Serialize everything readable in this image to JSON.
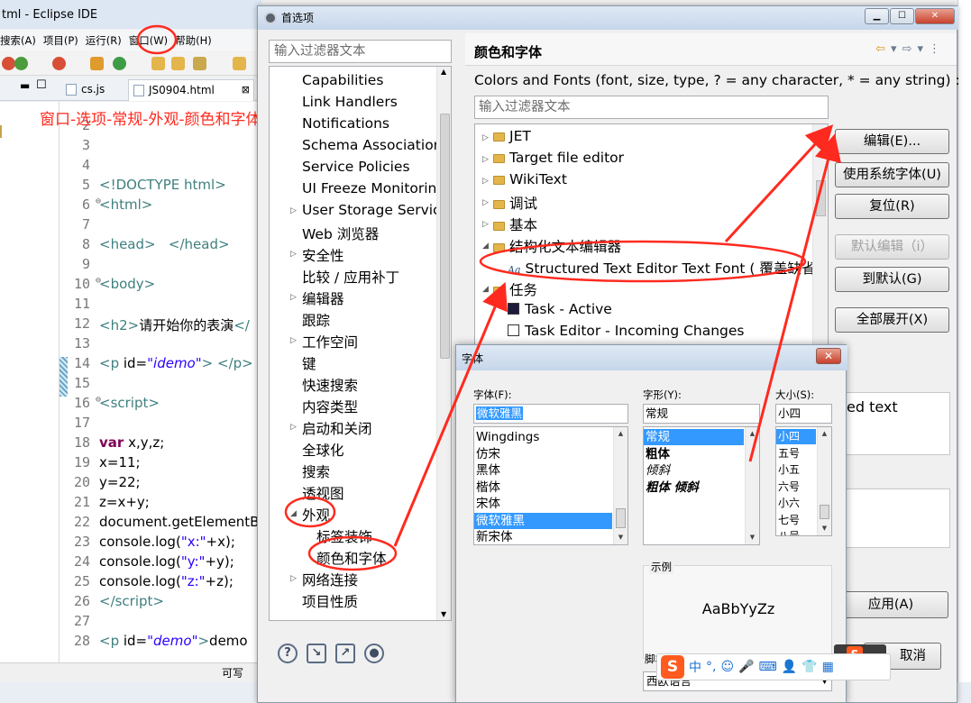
{
  "eclipse": {
    "title": "tml - Eclipse IDE",
    "menu": [
      "搜索(A)",
      "项目(P)",
      "运行(R)",
      "窗口(W)",
      "帮助(H)"
    ],
    "tabs": [
      {
        "label": "cs.js"
      },
      {
        "label": "JS0904.html"
      }
    ],
    "annotation": "窗口-选项-常规-外观-颜色和字体",
    "status": "可写",
    "lines": [
      {
        "num": "2",
        "html": ""
      },
      {
        "num": "3",
        "html": ""
      },
      {
        "num": "4",
        "html": ""
      },
      {
        "num": "5",
        "html": "<span class='tag'>&lt;!DOCTYPE html&gt;</span>"
      },
      {
        "num": "6",
        "html": "<span class='tag'>&lt;html&gt;</span>",
        "fold": true
      },
      {
        "num": "7",
        "html": ""
      },
      {
        "num": "8",
        "html": "<span class='tag'>&lt;head&gt;</span>&nbsp;&nbsp;&nbsp;<span class='tag'>&lt;/head&gt;</span>"
      },
      {
        "num": "9",
        "html": ""
      },
      {
        "num": "10",
        "html": "<span class='tag'>&lt;body&gt;</span>",
        "fold": true
      },
      {
        "num": "11",
        "html": ""
      },
      {
        "num": "12",
        "html": "<span class='tag'>&lt;h2&gt;</span>请开始你的表演<span class='tag'>&lt;/</span>"
      },
      {
        "num": "13",
        "html": ""
      },
      {
        "num": "14",
        "html": "<span class='tag'>&lt;p</span> id=<span class='attrv'>\"idemo\"</span><span class='tag'>&gt;</span> <span class='tag'>&lt;/p&gt;</span>"
      },
      {
        "num": "15",
        "html": ""
      },
      {
        "num": "16",
        "html": "<span class='tag'>&lt;script&gt;</span>",
        "fold": true
      },
      {
        "num": "17",
        "html": ""
      },
      {
        "num": "18",
        "html": "<span class='kw'>var</span> x,y,z;"
      },
      {
        "num": "19",
        "html": "x=11;"
      },
      {
        "num": "20",
        "html": "y=22;"
      },
      {
        "num": "21",
        "html": "z=x+y;"
      },
      {
        "num": "22",
        "html": "document.getElementB"
      },
      {
        "num": "23",
        "html": " console.log(<span class='str'>\"x:\"</span>+x);"
      },
      {
        "num": "24",
        "html": " console.log(<span class='str'>\"y:\"</span>+y);"
      },
      {
        "num": "25",
        "html": " console.log(<span class='str'>\"z:\"</span>+z);"
      },
      {
        "num": "26",
        "html": "<span class='tag'>&lt;/script&gt;</span>"
      },
      {
        "num": "27",
        "html": ""
      },
      {
        "num": "28",
        "html": "<span class='tag'>&lt;p</span> id=<span class='attrv'>\"demo\"</span><span class='tag'>&gt;</span>demo"
      }
    ]
  },
  "prefs": {
    "title": "首选项",
    "filter_placeholder": "输入过滤器文本",
    "tree": [
      {
        "label": "Capabilities",
        "level": 1,
        "arrow": ""
      },
      {
        "label": "Link Handlers",
        "level": 1,
        "arrow": ""
      },
      {
        "label": "Notifications",
        "level": 1,
        "arrow": ""
      },
      {
        "label": "Schema Association",
        "level": 1,
        "arrow": ""
      },
      {
        "label": "Service Policies",
        "level": 1,
        "arrow": ""
      },
      {
        "label": "UI Freeze Monitorin",
        "level": 1,
        "arrow": ""
      },
      {
        "label": "User Storage Servic",
        "level": 1,
        "arrow": "▷"
      },
      {
        "label": "Web 浏览器",
        "level": 1,
        "arrow": ""
      },
      {
        "label": "安全性",
        "level": 1,
        "arrow": "▷"
      },
      {
        "label": "比较 / 应用补丁",
        "level": 1,
        "arrow": ""
      },
      {
        "label": "编辑器",
        "level": 1,
        "arrow": "▷"
      },
      {
        "label": "跟踪",
        "level": 1,
        "arrow": ""
      },
      {
        "label": "工作空间",
        "level": 1,
        "arrow": "▷"
      },
      {
        "label": "键",
        "level": 1,
        "arrow": ""
      },
      {
        "label": "快速搜索",
        "level": 1,
        "arrow": ""
      },
      {
        "label": "内容类型",
        "level": 1,
        "arrow": ""
      },
      {
        "label": "启动和关闭",
        "level": 1,
        "arrow": "▷"
      },
      {
        "label": "全球化",
        "level": 1,
        "arrow": ""
      },
      {
        "label": "搜索",
        "level": 1,
        "arrow": ""
      },
      {
        "label": "透视图",
        "level": 1,
        "arrow": ""
      },
      {
        "label": "外观",
        "level": 1,
        "arrow": "◢"
      },
      {
        "label": "标签装饰",
        "level": 2,
        "arrow": ""
      },
      {
        "label": "颜色和字体",
        "level": 2,
        "arrow": ""
      },
      {
        "label": "网络连接",
        "level": 1,
        "arrow": "▷"
      },
      {
        "label": "项目性质",
        "level": 1,
        "arrow": ""
      }
    ],
    "page_title": "颜色和字体",
    "description": "Colors and Fonts (font, size, type, ? = any character, * = any string) :",
    "cf_filter_placeholder": "输入过滤器文本",
    "cf_tree": [
      {
        "label": "JET",
        "type": "folder",
        "arrow": "▷",
        "level": 0
      },
      {
        "label": "Target file editor",
        "type": "folder",
        "arrow": "▷",
        "level": 0
      },
      {
        "label": "WikiText",
        "type": "folder",
        "arrow": "▷",
        "level": 0
      },
      {
        "label": "调试",
        "type": "folder",
        "arrow": "▷",
        "level": 0
      },
      {
        "label": "基本",
        "type": "folder",
        "arrow": "▷",
        "level": 0
      },
      {
        "label": "结构化文本编辑器",
        "type": "folder",
        "arrow": "◢",
        "level": 0
      },
      {
        "label": "Structured Text Editor Text Font ( 覆盖缺省",
        "type": "font",
        "arrow": "",
        "level": 1
      },
      {
        "label": "任务",
        "type": "folder",
        "arrow": "◢",
        "level": 0
      },
      {
        "label": "Task - Active",
        "type": "color-dark",
        "arrow": "",
        "level": 1
      },
      {
        "label": "Task Editor - Incoming Changes",
        "type": "color-light",
        "arrow": "",
        "level": 1
      }
    ],
    "buttons": {
      "edit": "编辑(E)...",
      "use_system_font": "使用系统字体(U)",
      "reset": "复位(R)",
      "edit_default": "默认编辑（i）",
      "go_to_default": "到默认(G)",
      "expand_all": "全部展开(X)",
      "apply": "应用(A)",
      "cancel": "取消"
    },
    "preview_text": "ed text"
  },
  "font_dialog": {
    "title": "字体",
    "font_label": "字体(F):",
    "style_label": "字形(Y):",
    "size_label": "大小(S):",
    "font_value": "微软雅黑",
    "style_value": "常规",
    "size_value": "小四",
    "fonts": [
      "Wingdings",
      "仿宋",
      "黑体",
      "楷体",
      "宋体",
      "微软雅黑",
      "新宋体"
    ],
    "styles": [
      "常规",
      "粗体",
      "倾斜",
      "粗体 倾斜"
    ],
    "sizes": [
      "小四",
      "五号",
      "小五",
      "六号",
      "小六",
      "七号",
      "八号"
    ],
    "sample_label": "示例",
    "sample_text": "AaBbYyZz",
    "script_label": "脚本(R):",
    "script_value": "西欧语言"
  },
  "ime": {
    "logo": "S",
    "items": [
      "中",
      "°,"
    ]
  },
  "colors": {
    "annotation_red": "#ff2a1f",
    "selection_blue": "#3399ff"
  }
}
